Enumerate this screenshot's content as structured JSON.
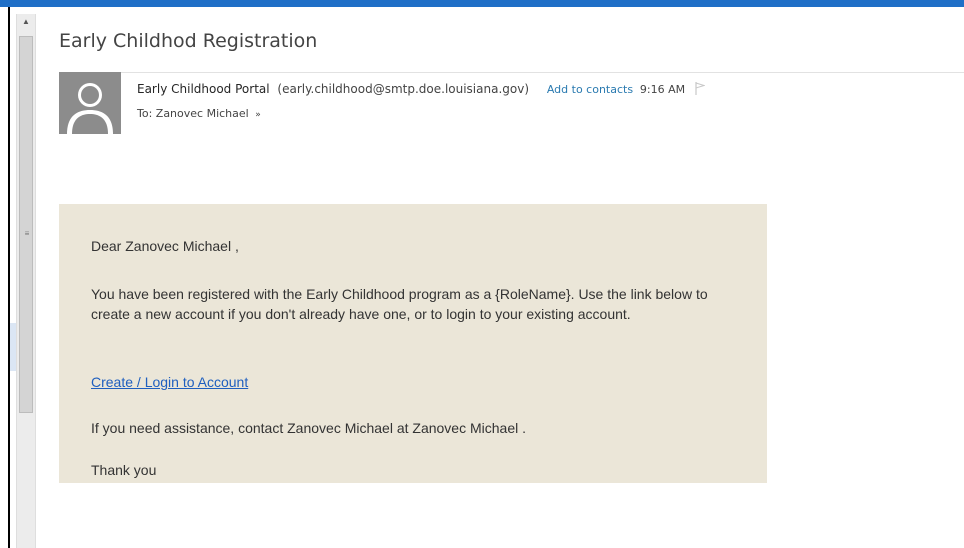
{
  "email": {
    "subject": "Early Childhod Registration",
    "sender_name": "Early Childhood Portal",
    "sender_email": "(early.childhood@smtp.doe.louisiana.gov)",
    "add_to_contacts": "Add to contacts",
    "time": "9:16 AM",
    "to_line": "To: Zanovec Michael",
    "to_expand_glyph": "»",
    "body": {
      "greeting": "Dear Zanovec Michael ,",
      "paragraph": "You have been registered with the Early Childhood program as a {RoleName}. Use the link below to create a new account if you don't already have one, or to login to your existing account.",
      "link_text": "Create / Login to Account",
      "assistance": "If you need assistance, contact Zanovec Michael at Zanovec Michael .",
      "closing": "Thank you"
    }
  },
  "icons": {
    "avatar": "person-silhouette-icon",
    "flag": "flag-icon",
    "scroll_up": "scroll-up-arrow-icon",
    "scroll_grip": "scroll-grip-icon"
  },
  "colors": {
    "accent_bar": "#1f6fc7",
    "link": "#1f5fbf",
    "body_background": "#ebe6d8",
    "avatar_background": "#8c8c8c"
  }
}
